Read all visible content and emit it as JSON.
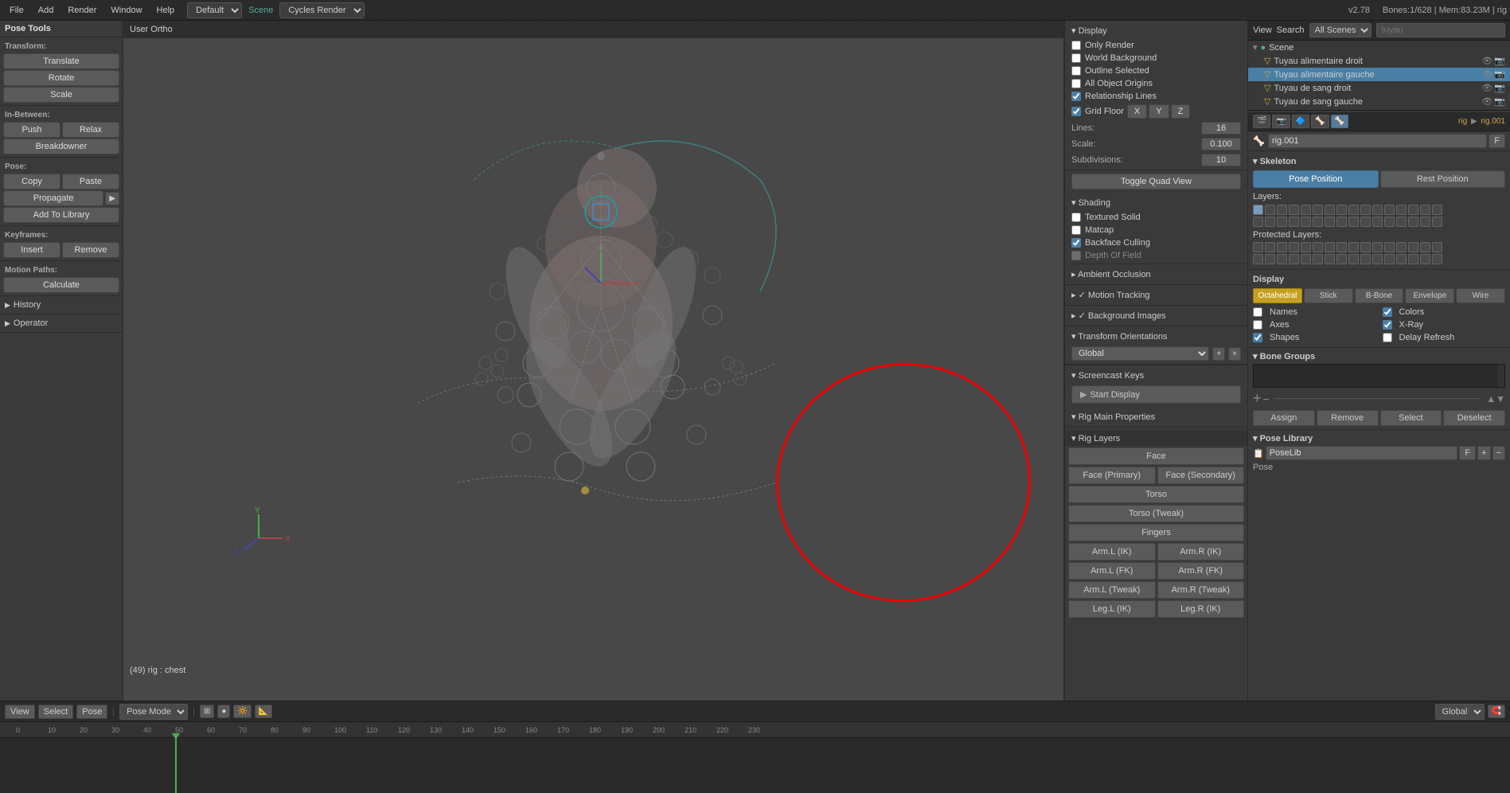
{
  "topbar": {
    "menus": [
      "File",
      "Add",
      "Render",
      "Window",
      "Help"
    ],
    "mode": "Default",
    "scene": "Scene",
    "engine": "Cycles Render",
    "version": "v2.78",
    "info": "Bones:1/628 | Mem:83.23M | rig"
  },
  "left_panel": {
    "title": "Pose Tools",
    "transform_label": "Transform:",
    "buttons": {
      "translate": "Translate",
      "rotate": "Rotate",
      "scale": "Scale",
      "in_between_label": "In-Between:",
      "push": "Push",
      "relax": "Relax",
      "breakdowner": "Breakdowner",
      "pose_label": "Pose:",
      "copy": "Copy",
      "paste": "Paste",
      "propagate": "Propagate",
      "add_library": "Add To Library",
      "keyframes_label": "Keyframes:",
      "insert": "Insert",
      "remove": "Remove",
      "motion_paths_label": "Motion Paths:",
      "calculate": "Calculate"
    },
    "history": "History",
    "operator": "Operator"
  },
  "viewport": {
    "label": "User Ortho",
    "status": "(49) rig : chest"
  },
  "properties_panel": {
    "display_header": "▾ Display",
    "only_render": "Only Render",
    "world_background": "World Background",
    "outline_selected": "Outline Selected",
    "all_object_origins": "All Object Origins",
    "relationship_lines": "Relationship Lines",
    "grid_floor": "Grid Floor",
    "axis_x": "X",
    "axis_y": "Y",
    "axis_z": "Z",
    "lines_label": "Lines:",
    "lines_val": "16",
    "scale_label": "Scale:",
    "scale_val": "0.100",
    "subdiv_label": "Subdivisions:",
    "subdiv_val": "10",
    "toggle_quad": "Toggle Quad View",
    "shading_header": "▾ Shading",
    "textured_solid": "Textured Solid",
    "matcap": "Matcap",
    "backface_culling": "Backface Culling",
    "depth_of_field": "Depth Of Field",
    "ambient_occlusion": "▸ Ambient Occlusion",
    "motion_tracking": "▸ ✓ Motion Tracking",
    "background_images": "▸ ✓ Background Images",
    "transform_orientations": "▾ Transform Orientations",
    "global": "Global",
    "screencast_keys": "▾ Screencast Keys",
    "start_display": "Start Display",
    "rig_main_props": "▾ Rig Main Properties",
    "rig_layers": "▾ Rig Layers",
    "rig_layer_buttons": [
      "Face",
      "Face (Primary)",
      "Face (Secondary)",
      "Torso",
      "Torso (Tweak)",
      "Fingers",
      "Arm.L (IK)",
      "Arm.R (IK)",
      "Arm.L (FK)",
      "Arm.R (FK)",
      "Arm.L (Tweak)",
      "Arm.R (Tweak)",
      "Leg.L (IK)",
      "Leg.R (IK)"
    ]
  },
  "far_right": {
    "view_label": "View",
    "search_label": "Search",
    "all_scenes": "All Scenes",
    "user": "tuyau",
    "scene_label": "Scene",
    "items": [
      {
        "name": "Tuyau alimentaire droit",
        "visible": true,
        "selected": false
      },
      {
        "name": "Tuyau alimentaire gauche",
        "visible": true,
        "selected": true
      },
      {
        "name": "Tuyau de sang droit",
        "visible": true,
        "selected": false
      },
      {
        "name": "Tuyau de sang gauche",
        "visible": true,
        "selected": false
      }
    ],
    "rig_label": "rig",
    "rig001_label": "rig.001",
    "skeleton_label": "▾ Skeleton",
    "pose_position": "Pose Position",
    "rest_position": "Rest Position",
    "layers_label": "Layers:",
    "protected_layers": "Protected Layers:",
    "display_title": "Display",
    "display_modes": [
      "Octahedral",
      "Stick",
      "B-Bone",
      "Envelope",
      "Wire"
    ],
    "active_display": "Octahedral",
    "names_label": "Names",
    "axes_label": "Axes",
    "shapes_label": "Shapes",
    "colors_label": "Colors",
    "x_ray_label": "X-Ray",
    "delay_refresh": "Delay Refresh",
    "bone_groups_label": "▾ Bone Groups",
    "bg_actions": [
      "Assign",
      "Remove",
      "Select",
      "Deselect"
    ],
    "pose_library_label": "▾ Pose Library",
    "pose_lib_name": "PoseLib",
    "pose_label": "Pose"
  },
  "bottom_bar": {
    "view_btn": "View",
    "select_btn": "Select",
    "pose_btn": "Pose",
    "mode": "Pose Mode",
    "global": "Global"
  },
  "annotation": {
    "color": "#dd0000"
  }
}
